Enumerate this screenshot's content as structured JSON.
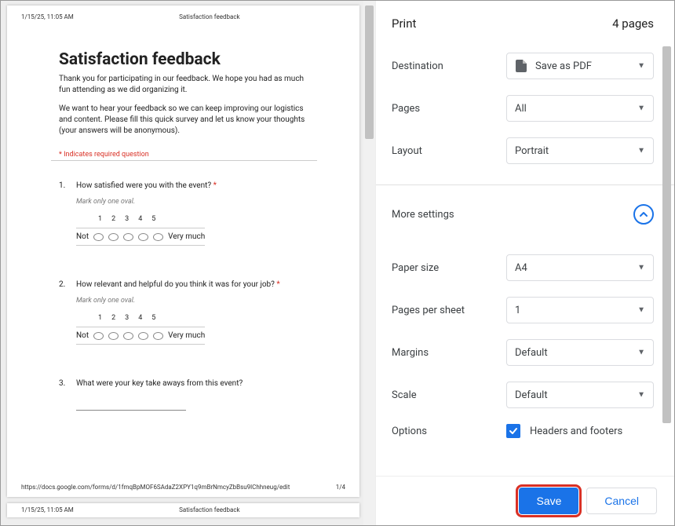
{
  "preview": {
    "header_left": "1/15/25, 11:05 AM",
    "header_center": "Satisfaction feedback",
    "title": "Satisfaction feedback",
    "intro1": "Thank you for participating in our feedback. We hope you had as much fun attending as we did organizing it.",
    "intro2": "We want to hear your feedback so we can keep improving our logistics and content. Please fill this quick survey and let us know your thoughts (your answers will be anonymous).",
    "required_note": "* Indicates required question",
    "questions": [
      {
        "num": "1.",
        "text": "How satisfied were you with the event?",
        "required": "*",
        "hint": "Mark only one oval.",
        "type": "scale",
        "left": "Not",
        "right": "Very much",
        "nums": [
          "1",
          "2",
          "3",
          "4",
          "5"
        ]
      },
      {
        "num": "2.",
        "text": "How relevant and helpful do you think it was for your job?",
        "required": "*",
        "hint": "Mark only one oval.",
        "type": "scale",
        "left": "Not",
        "right": "Very much",
        "nums": [
          "1",
          "2",
          "3",
          "4",
          "5"
        ]
      },
      {
        "num": "3.",
        "text": "What were your key take aways from this event?",
        "required": "",
        "hint": "",
        "type": "text"
      }
    ],
    "footer_url": "https://docs.google.com/forms/d/1fmqBpMOF6SAdaZ2XPY1q9mBrNmcyZbBsu9lChhneug/edit",
    "footer_page": "1/4"
  },
  "panel": {
    "title": "Print",
    "page_count": "4 pages",
    "rows": {
      "destination": {
        "label": "Destination",
        "value": "Save as PDF"
      },
      "pages": {
        "label": "Pages",
        "value": "All"
      },
      "layout": {
        "label": "Layout",
        "value": "Portrait"
      }
    },
    "more_label": "More settings",
    "advanced": {
      "paper_size": {
        "label": "Paper size",
        "value": "A4"
      },
      "pages_per_sheet": {
        "label": "Pages per sheet",
        "value": "1"
      },
      "margins": {
        "label": "Margins",
        "value": "Default"
      },
      "scale": {
        "label": "Scale",
        "value": "Default"
      },
      "options": {
        "label": "Options",
        "checkbox": "Headers and footers"
      }
    },
    "buttons": {
      "save": "Save",
      "cancel": "Cancel"
    }
  }
}
